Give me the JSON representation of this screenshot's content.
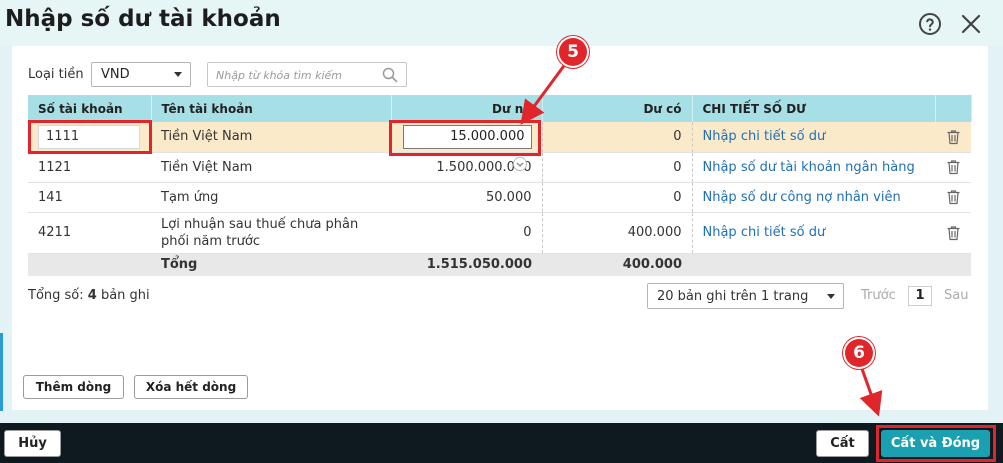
{
  "dialog": {
    "title": "Nhập số dư tài khoản"
  },
  "filters": {
    "currency_label": "Loại tiền",
    "currency_value": "VND",
    "search_placeholder": "Nhập từ khóa tìm kiếm"
  },
  "table": {
    "headers": [
      "Số tài khoản",
      "Tên tài khoản",
      "Dư nợ",
      "Dư có",
      "CHI TIẾT SỐ DƯ"
    ],
    "rows": [
      {
        "account": "1111",
        "name": "Tiền Việt Nam",
        "debit": "15.000.000",
        "credit": "0",
        "detail": "Nhập chi tiết số dư"
      },
      {
        "account": "1121",
        "name": "Tiền Việt Nam",
        "debit": "1.500.000.000",
        "credit": "0",
        "detail": "Nhập số dư tài khoản ngân hàng"
      },
      {
        "account": "141",
        "name": "Tạm ứng",
        "debit": "50.000",
        "credit": "0",
        "detail": "Nhập số dư công nợ nhân viên"
      },
      {
        "account": "4211",
        "name": "Lợi nhuận sau thuế chưa phân phối năm trước",
        "debit": "0",
        "credit": "400.000",
        "detail": "Nhập chi tiết số dư"
      }
    ],
    "total": {
      "label": "Tổng",
      "debit": "1.515.050.000",
      "credit": "400.000"
    }
  },
  "pagination": {
    "total_prefix": "Tổng số:",
    "total_count": "4",
    "total_suffix": "bản ghi",
    "page_size": "20 bản ghi trên 1 trang",
    "prev": "Trước",
    "page": "1",
    "next": "Sau"
  },
  "actions": {
    "add_row": "Thêm dòng",
    "clear_rows": "Xóa hết dòng",
    "cancel": "Hủy",
    "save": "Cất",
    "save_close": "Cất và Đóng"
  },
  "annotations": {
    "step5": "5",
    "step6": "6"
  },
  "colors": {
    "header_bg": "#a7dfe6",
    "selected_row": "#fbeac9",
    "primary_button": "#1aa0b1",
    "annotation_red": "#e0262b",
    "link": "#1f6fb5"
  }
}
